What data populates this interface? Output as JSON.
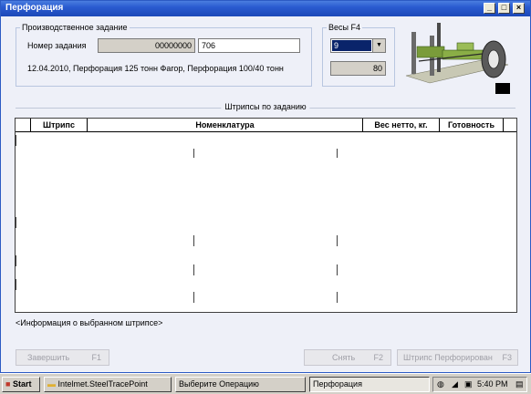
{
  "window": {
    "title": "Перфорация"
  },
  "task_group": {
    "title": "Производственное задание",
    "number_label": "Номер задания",
    "number_value": "00000000",
    "number_input": "706",
    "description": "12.04.2010, Перфорация 125 тонн Фагор, Перфорация 100/40 тонн"
  },
  "scale_group": {
    "title": "Весы  F4",
    "selected": "9",
    "weight": "80"
  },
  "strips": {
    "title": "Штрипсы по заданию",
    "columns": [
      "Штрипс",
      "Номенклатура",
      "Вес нетто, кг.",
      "Готовность"
    ]
  },
  "info_text": "<Информация о выбранном штрипсе>",
  "buttons": {
    "finish": {
      "label": "Завершить",
      "key": "F1"
    },
    "remove": {
      "label": "Снять",
      "key": "F2"
    },
    "perforated": {
      "label": "Штрипс Перфорирован",
      "key": "F3"
    }
  },
  "taskbar": {
    "start": "Start",
    "task1": "Intelmet.SteelTracePoint",
    "task2": "Выберите Операцию",
    "task3": "Перфорация",
    "time": "5:40 PM"
  }
}
